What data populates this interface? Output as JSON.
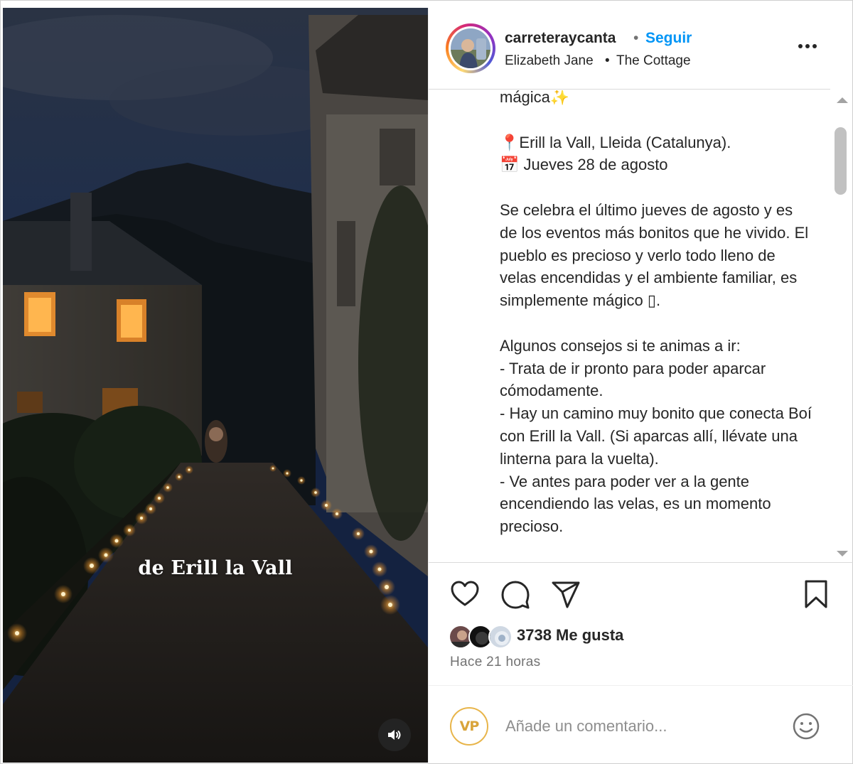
{
  "media": {
    "overlay_text": "de Erill la Vall",
    "sound_icon": "speaker-icon"
  },
  "header": {
    "username": "carreteraycanta",
    "separator": "•",
    "follow_label": "Seguir",
    "audio_author": "Elizabeth Jane",
    "audio_separator": "•",
    "audio_title": "The Cottage",
    "more_icon": "more-options-icon"
  },
  "caption": {
    "text": "mágica✨\n\n📍Erill la Vall, Lleida (Catalunya).\n📅 Jueves 28 de agosto\n\nSe celebra el último jueves de agosto y es de los eventos más bonitos que he vivido. El pueblo es precioso y verlo todo lleno de velas encendidas y el ambiente familiar, es simplemente mágico ▯.\n\nAlgunos consejos si te animas a ir:\n- Trata de ir pronto para poder aparcar cómodamente.\n- Hay un camino muy bonito que conecta Boí con Erill la Vall. (Si aparcas allí, llévate una linterna para la vuelta).\n- Ve antes para poder ver a la gente encendiendo las velas, es un momento precioso."
  },
  "actions": {
    "like_icon": "heart-icon",
    "comment_icon": "comment-icon",
    "share_icon": "share-icon",
    "save_icon": "bookmark-icon",
    "likes": "3738 Me gusta",
    "time": "Hace 21 horas"
  },
  "comment": {
    "avatar_text": "VP",
    "placeholder": "Añade un comentario...",
    "emoji_icon": "emoji-icon"
  },
  "colors": {
    "accent": "#0095f6",
    "text": "#262626",
    "muted": "#737373",
    "candle": "#ffb347"
  }
}
